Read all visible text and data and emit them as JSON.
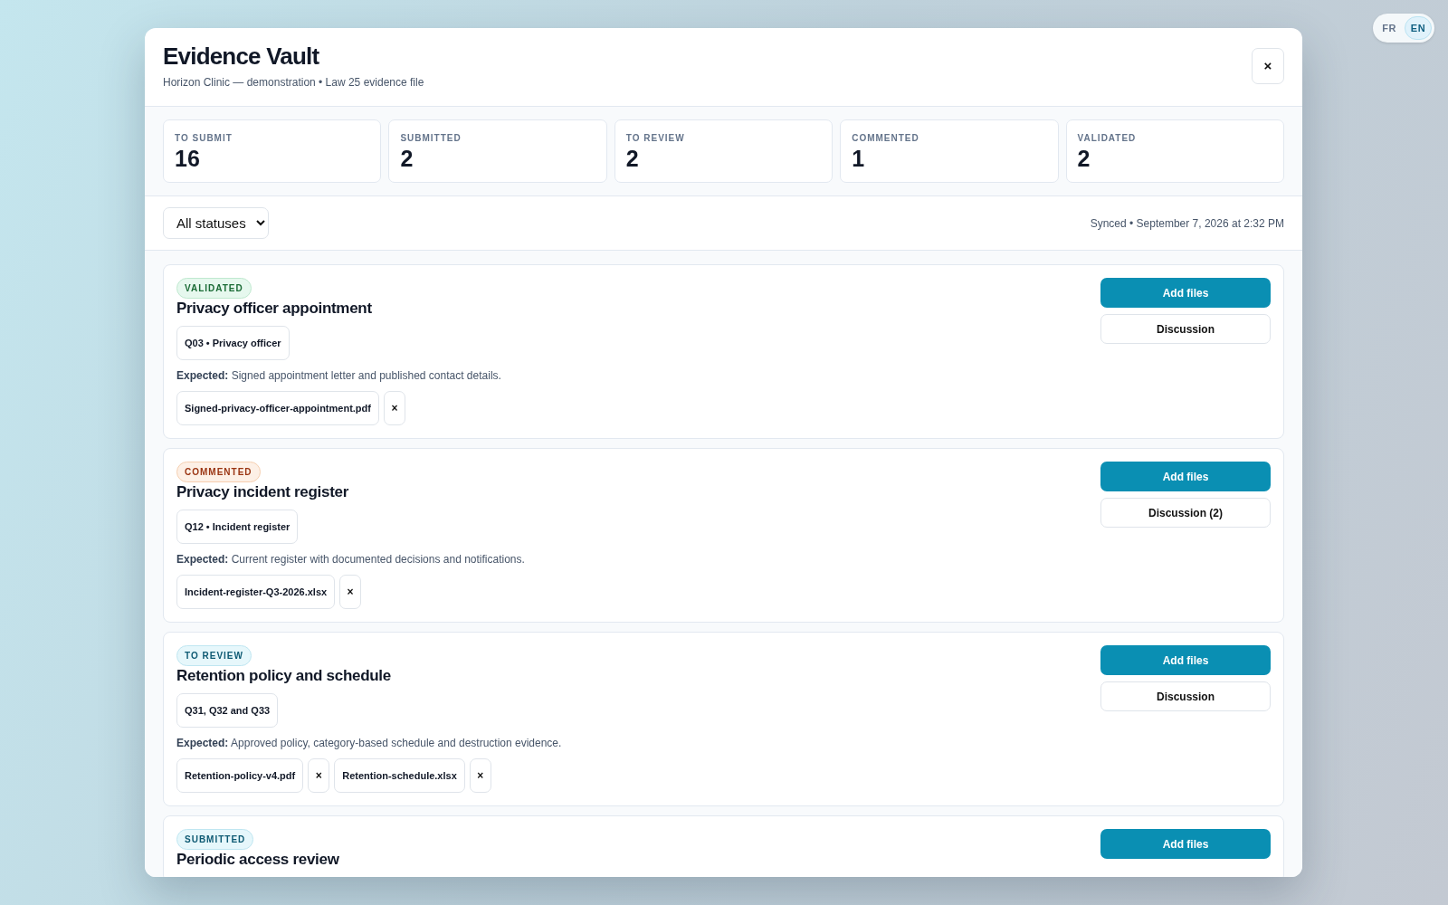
{
  "language_switch": [
    {
      "label": "FR",
      "selected": false
    },
    {
      "label": "EN",
      "selected": true
    }
  ],
  "header": {
    "title": "Evidence Vault",
    "subtitle": "Horizon Clinic — demonstration • Law 25 evidence file",
    "close": "×"
  },
  "stats": [
    {
      "label": "TO SUBMIT",
      "value": "16"
    },
    {
      "label": "SUBMITTED",
      "value": "2"
    },
    {
      "label": "TO REVIEW",
      "value": "2"
    },
    {
      "label": "COMMENTED",
      "value": "1"
    },
    {
      "label": "VALIDATED",
      "value": "2"
    }
  ],
  "filter": {
    "value": "All statuses"
  },
  "sync_status": "Synced • September 7, 2026 at 2:32 PM",
  "items": [
    {
      "kind": "validated",
      "badge": "VALIDATED",
      "title": "Privacy officer appointment",
      "reference": "Q03 • Privacy officer",
      "expected_label": "Expected:",
      "expected": "Signed appointment letter and published contact details.",
      "files": [
        {
          "name": "Signed-privacy-officer-appointment.pdf",
          "remove": "×"
        }
      ],
      "add_button": "Add files",
      "discussion_button": "Discussion"
    },
    {
      "kind": "commented",
      "badge": "COMMENTED",
      "title": "Privacy incident register",
      "reference": "Q12 • Incident register",
      "expected_label": "Expected:",
      "expected": "Current register with documented decisions and notifications.",
      "files": [
        {
          "name": "Incident-register-Q3-2026.xlsx",
          "remove": "×"
        }
      ],
      "add_button": "Add files",
      "discussion_button": "Discussion (2)"
    },
    {
      "kind": "to_review",
      "badge": "TO REVIEW",
      "title": "Retention policy and schedule",
      "reference": "Q31, Q32 and Q33",
      "expected_label": "Expected:",
      "expected": "Approved policy, category-based schedule and destruction evidence.",
      "files": [
        {
          "name": "Retention-policy-v4.pdf",
          "remove": "×"
        },
        {
          "name": "Retention-schedule.xlsx",
          "remove": "×"
        }
      ],
      "add_button": "Add files",
      "discussion_button": "Discussion"
    },
    {
      "kind": "submitted",
      "badge": "SUBMITTED",
      "title": "Periodic access review",
      "add_button": "Add files"
    }
  ]
}
